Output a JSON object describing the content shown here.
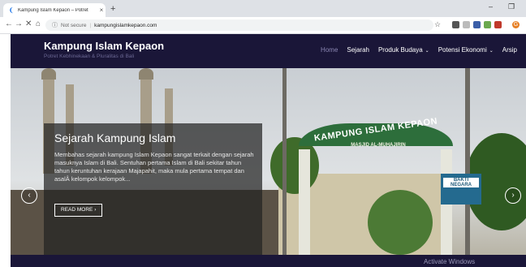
{
  "browser": {
    "tab_title": "Kampung Islam Kepaon – Potret",
    "tab_close": "×",
    "new_tab": "+",
    "minimize": "–",
    "restore": "❐",
    "nav_back": "←",
    "nav_forward": "→",
    "nav_reload": "✕",
    "nav_home": "⌂",
    "info_icon": "ⓘ",
    "security_text": "Not secure",
    "url": "kampungislamkepaon.com",
    "star": "☆",
    "menu_letter": "G"
  },
  "site": {
    "brand": "Kampung Islam Kepaon",
    "tagline": "Potret Kebhinekaan & Pluralitas di Bali",
    "menu": [
      {
        "label": "Home",
        "active": true,
        "dropdown": false
      },
      {
        "label": "Sejarah",
        "active": false,
        "dropdown": false
      },
      {
        "label": "Produk Budaya",
        "active": false,
        "dropdown": true
      },
      {
        "label": "Potensi Ekonomi",
        "active": false,
        "dropdown": true
      },
      {
        "label": "Arsip",
        "active": false,
        "dropdown": false
      }
    ],
    "dropdown_glyph": "⌄"
  },
  "slider": {
    "title": "Sejarah Kampung Islam",
    "text": "Membahas sejarah kampung Islam Kepaon sangat terkait dengan sejarah masuknya Islam di Bali. Sentuhan pertama Islam di Bali sekitar tahun tahun keruntuhan kerajaan Majapahit, maka mula pertama tempat dan asalÂ kelompok kelompok...",
    "read_more": "READ MORE",
    "read_more_glyph": "›",
    "prev": "‹",
    "next": "›",
    "gate_text": "KAMPUNG ISLAM KEPAON",
    "gate_sub": "MASJID AL-MUHAJIRIN",
    "board_name": "BAKTI NEGARA"
  },
  "os": {
    "watermark": "Activate Windows"
  },
  "colors": {
    "header_bg": "#1a1638",
    "active_menu": "#8b87b3"
  }
}
